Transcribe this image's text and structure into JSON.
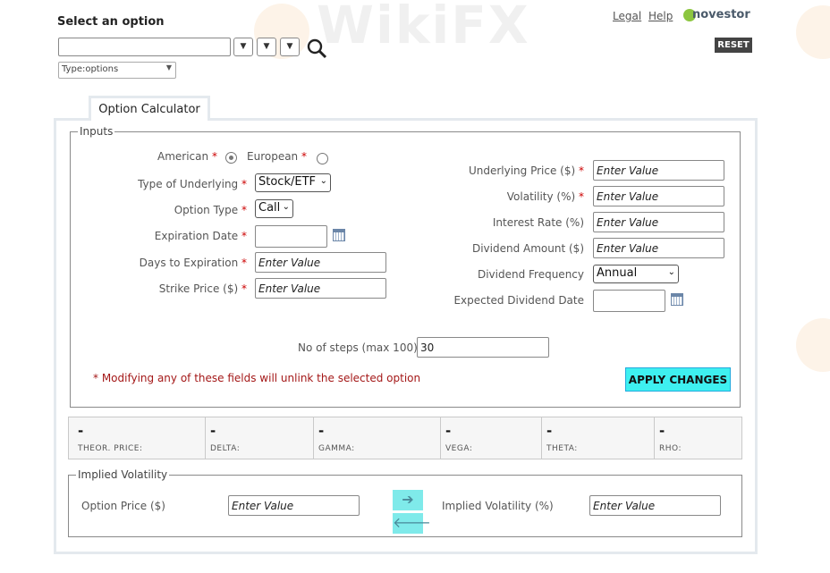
{
  "header": {
    "select_label": "Select an option",
    "type_filter": "Type:options",
    "links": {
      "legal": "Legal",
      "help": "Help"
    },
    "brand": "novestor",
    "reset_label": "RESET"
  },
  "watermark": "WikiFX",
  "calculator": {
    "tab_label": "Option Calculator",
    "inputs_legend": "Inputs",
    "american_label": "American",
    "european_label": "European",
    "style_selected": "American",
    "required_mark": "*",
    "underlying_type": {
      "label": "Type of Underlying",
      "value": "Stock/ETF"
    },
    "option_type": {
      "label": "Option Type",
      "value": "Call"
    },
    "expiration_date": {
      "label": "Expiration Date",
      "value": ""
    },
    "days_to_expiration": {
      "label": "Days to Expiration",
      "placeholder": "Enter Value"
    },
    "strike_price": {
      "label": "Strike Price ($)",
      "placeholder": "Enter Value"
    },
    "underlying_price": {
      "label": "Underlying Price ($)",
      "placeholder": "Enter Value"
    },
    "volatility": {
      "label": "Volatility (%)",
      "placeholder": "Enter Value"
    },
    "interest_rate": {
      "label": "Interest Rate (%)",
      "placeholder": "Enter Value"
    },
    "dividend_amount": {
      "label": "Dividend Amount ($)",
      "placeholder": "Enter Value"
    },
    "dividend_frequency": {
      "label": "Dividend Frequency",
      "value": "Annual"
    },
    "expected_dividend_date": {
      "label": "Expected Dividend Date",
      "value": ""
    },
    "steps": {
      "label": "No of steps (max 100)",
      "value": "30"
    },
    "warning": "* Modifying any of these fields will unlink the selected option",
    "apply_label": "APPLY CHANGES"
  },
  "greeks": [
    {
      "name": "THEOR. PRICE:",
      "value": "-"
    },
    {
      "name": "DELTA:",
      "value": "-"
    },
    {
      "name": "GAMMA:",
      "value": "-"
    },
    {
      "name": "VEGA:",
      "value": "-"
    },
    {
      "name": "THETA:",
      "value": "-"
    },
    {
      "name": "RHO:",
      "value": "-"
    }
  ],
  "implied_volatility": {
    "legend": "Implied Volatility",
    "option_price_label": "Option Price ($)",
    "option_price_placeholder": "Enter Value",
    "iv_label": "Implied Volatility (%)",
    "iv_placeholder": "Enter Value",
    "arrow_right": "➔",
    "arrow_left": "🡐"
  },
  "icons": {
    "search": "search-icon",
    "calendar": "calendar-icon",
    "dropdown": "chevron-down-icon"
  },
  "colors": {
    "apply_button": "#3ef0f0",
    "reset_button": "#444444",
    "panel_border": "#e4e9ee",
    "required": "#cc0000",
    "warning": "#a41818"
  }
}
